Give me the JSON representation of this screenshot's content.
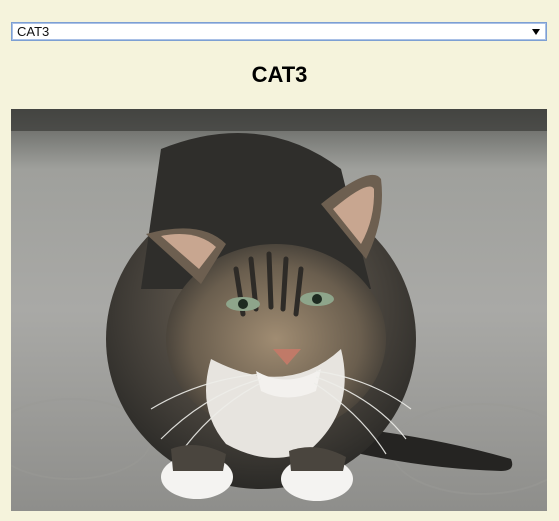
{
  "dropdown": {
    "selected": "CAT3",
    "arrow_icon": "dropdown-arrow-icon"
  },
  "heading": "CAT3",
  "image": {
    "subject": "cat-photo"
  }
}
